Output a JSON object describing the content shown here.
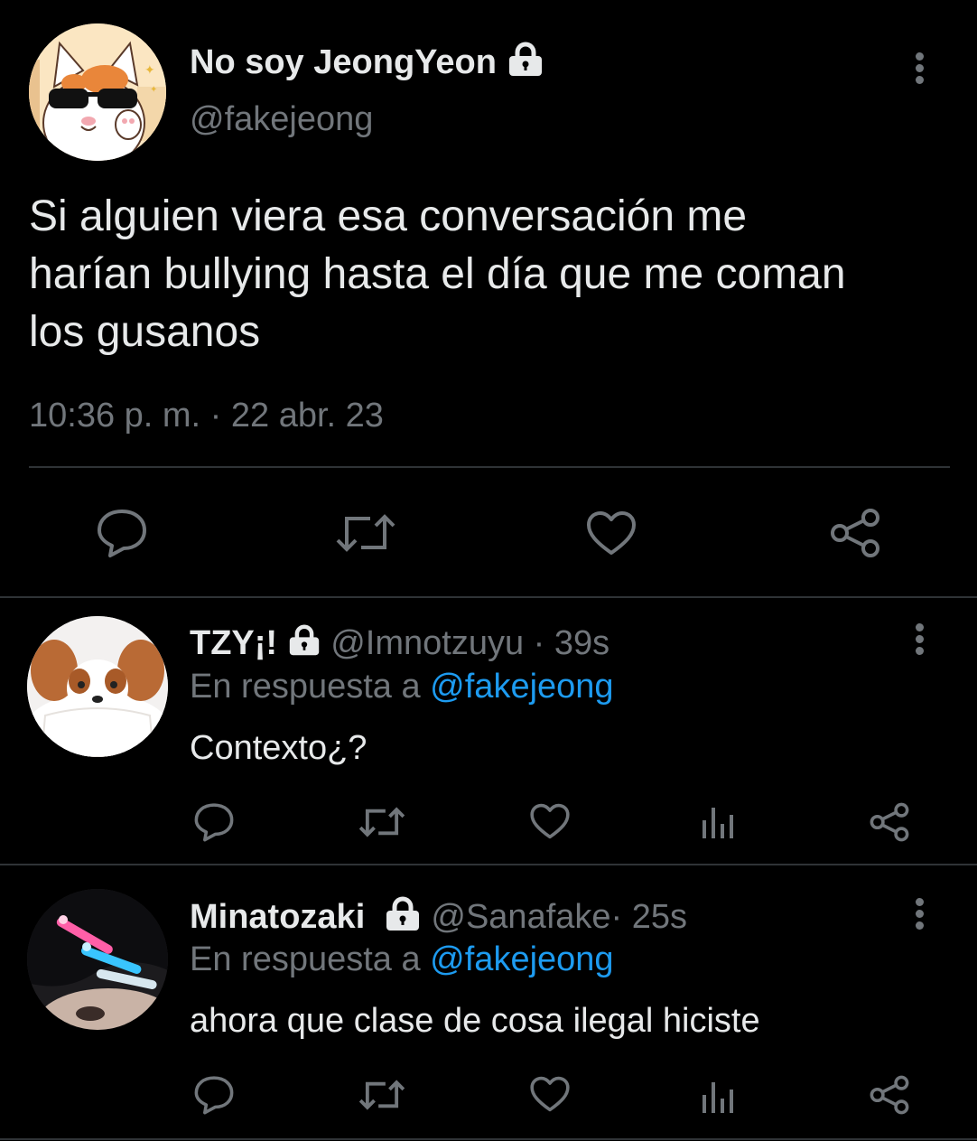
{
  "main_tweet": {
    "display_name": "No soy JeongYeon",
    "handle": "@fakejeong",
    "text_lines": [
      "Si alguien viera esa conversación me",
      "harían bullying hasta el día que me coman",
      "los gusanos"
    ],
    "timestamp": "10:36 p. m. · 22 abr. 23",
    "actions": [
      "reply-icon",
      "retweet-icon",
      "like-icon",
      "share-icon"
    ]
  },
  "replies": [
    {
      "display_name": "TZY¡!",
      "handle": "@Imnotzuyu",
      "time": "· 39s",
      "in_reply_prefix": "En respuesta a",
      "in_reply_handle": "@fakejeong",
      "text": "Contexto¿?"
    },
    {
      "display_name": "Minatozaki",
      "handle": "@Sanafake",
      "time": "· 25s",
      "in_reply_prefix": "En respuesta a",
      "in_reply_handle": "@fakejeong",
      "text": "ahora que clase de cosa ilegal hiciste"
    }
  ],
  "colors": {
    "background": "#000000",
    "text": "#e7e9ea",
    "muted": "#71767b",
    "link": "#1d9bf0",
    "divider": "#2f3336"
  }
}
